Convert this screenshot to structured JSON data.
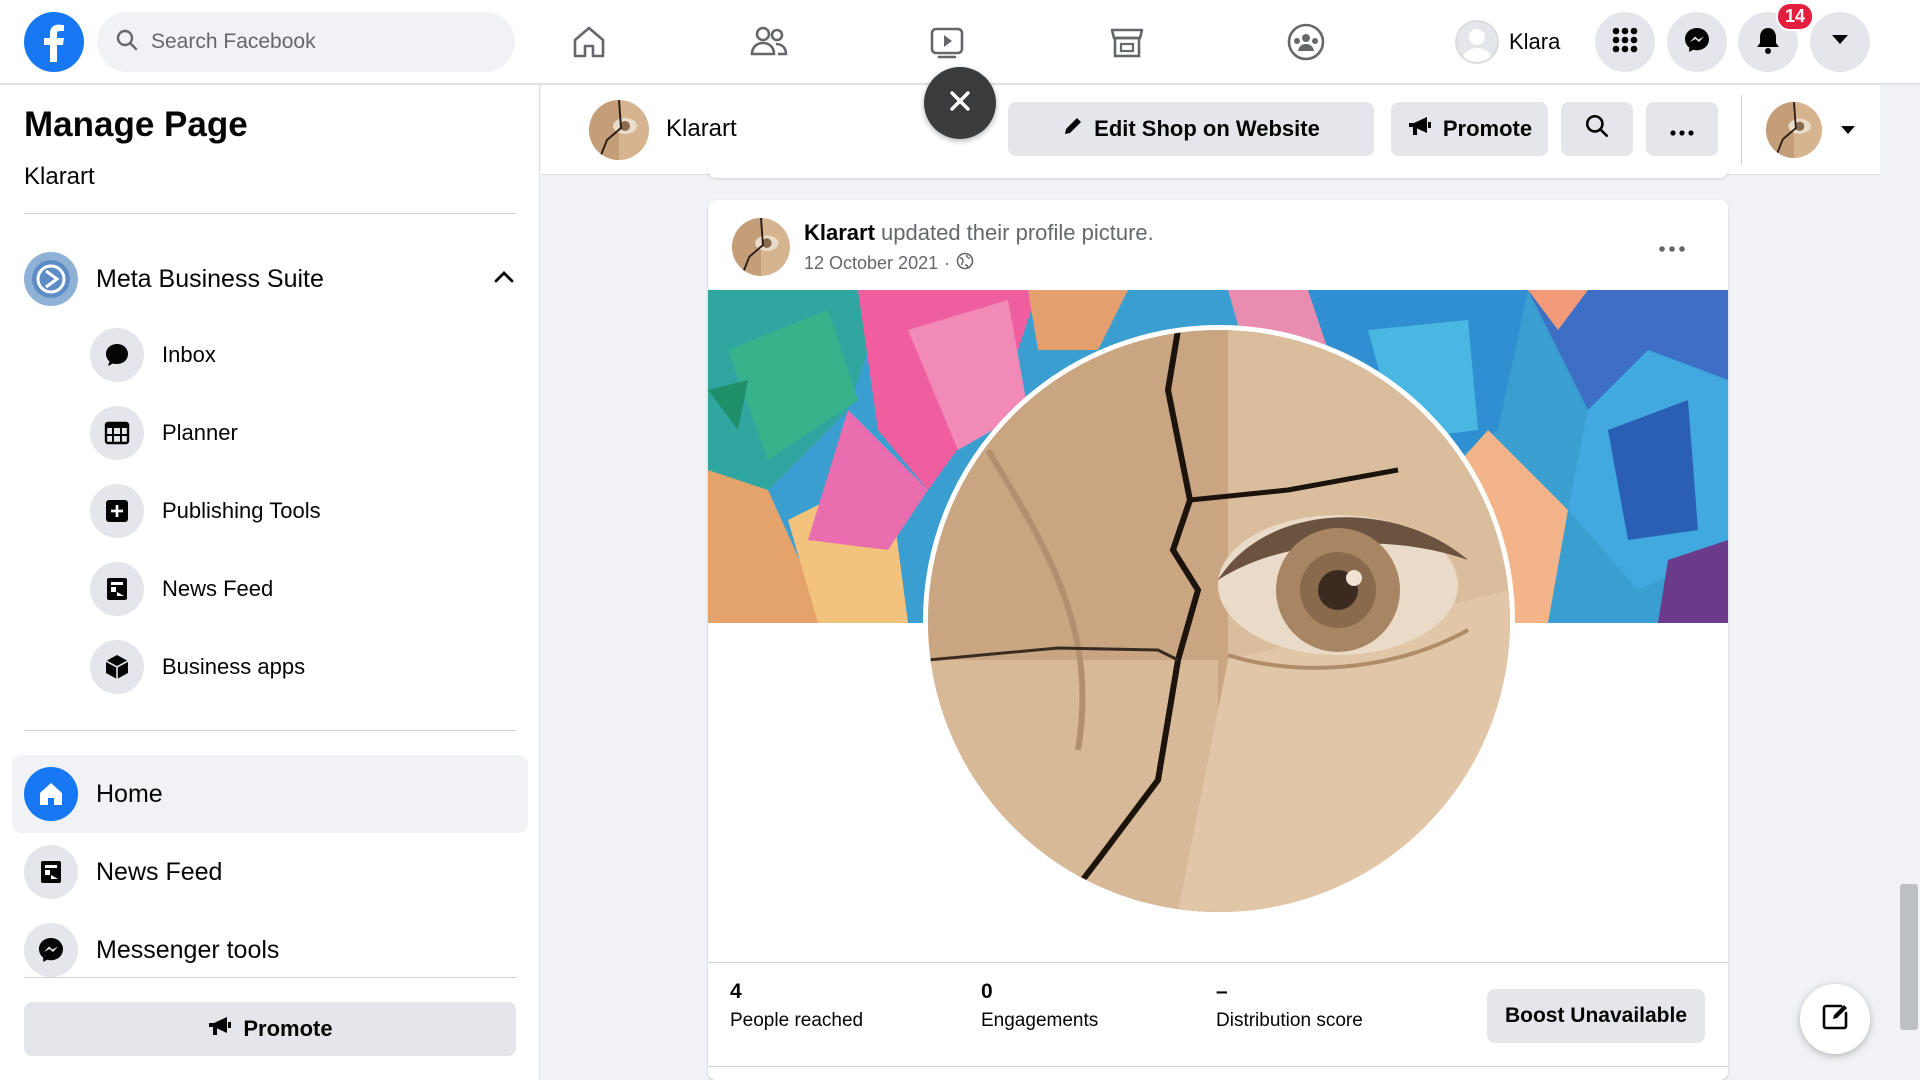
{
  "topbar": {
    "search_placeholder": "Search Facebook",
    "profile_name": "Klara",
    "notifications_count": "14",
    "nav_icons": [
      "home-icon",
      "friends-icon",
      "watch-icon",
      "marketplace-icon",
      "groups-icon"
    ],
    "brand_color": "#1877f2"
  },
  "sidebar": {
    "title": "Manage Page",
    "page_name": "Klarart",
    "business_suite": "Meta Business Suite",
    "suite_items": [
      {
        "label": "Inbox",
        "icon": "chat-icon"
      },
      {
        "label": "Planner",
        "icon": "calendar-icon"
      },
      {
        "label": "Publishing Tools",
        "icon": "publishing-icon"
      },
      {
        "label": "News Feed",
        "icon": "newsfeed-icon"
      },
      {
        "label": "Business apps",
        "icon": "cube-icon"
      }
    ],
    "main_items": [
      {
        "label": "Home",
        "icon": "home-icon",
        "active": true
      },
      {
        "label": "News Feed",
        "icon": "newsfeed-icon",
        "active": false
      },
      {
        "label": "Messenger tools",
        "icon": "messenger-icon",
        "active": false
      }
    ],
    "promote_label": "Promote"
  },
  "page_header": {
    "name": "Klarart",
    "edit_shop_label": "Edit Shop on Website",
    "promote_label": "Promote"
  },
  "post": {
    "author": "Klarart",
    "action": " updated their profile picture.",
    "date": "12 October 2021",
    "date_sep": "·",
    "stats": [
      {
        "value": "4",
        "label": "People reached"
      },
      {
        "value": "0",
        "label": "Engagements"
      },
      {
        "value": "–",
        "label": "Distribution score"
      }
    ],
    "boost_label": "Boost Unavailable"
  }
}
